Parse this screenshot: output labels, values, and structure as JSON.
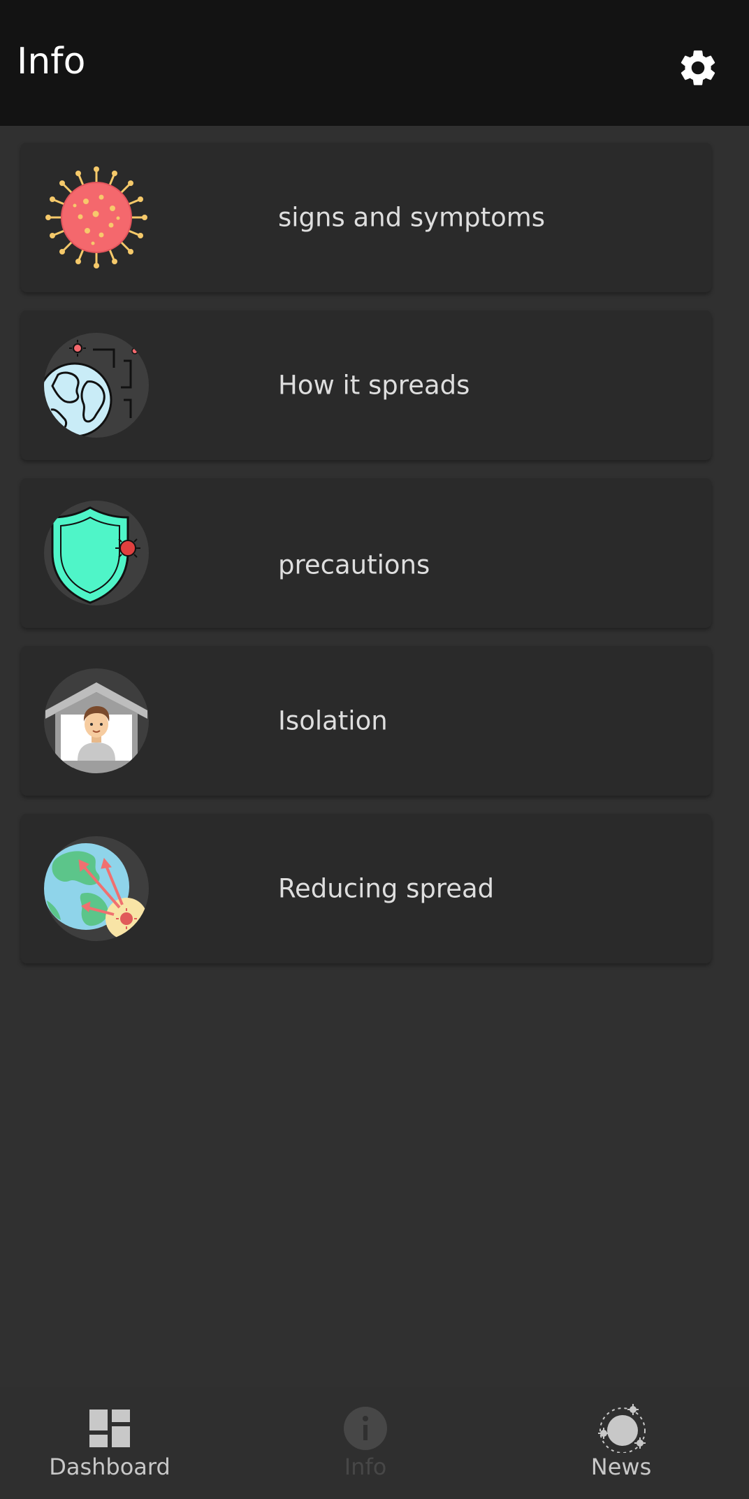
{
  "app_bar": {
    "title": "Info",
    "settings_icon": "gear-icon"
  },
  "cards": [
    {
      "label": "signs and symptoms",
      "icon": "virus-icon"
    },
    {
      "label": "How it spreads",
      "icon": "globe-spread-icon"
    },
    {
      "label": "precautions",
      "icon": "shield-virus-icon"
    },
    {
      "label": "Isolation",
      "icon": "home-isolation-icon"
    },
    {
      "label": "Reducing spread",
      "icon": "globe-reduce-spread-icon"
    }
  ],
  "bottom_nav": {
    "items": [
      {
        "label": "Dashboard",
        "icon": "dashboard-icon",
        "active": true
      },
      {
        "label": "Info",
        "icon": "info-icon",
        "active": false
      },
      {
        "label": "News",
        "icon": "news-virus-icon",
        "active": true
      }
    ]
  },
  "colors": {
    "app_bar_bg": "#131313",
    "page_bg": "#303030",
    "card_bg": "#2a2a2a",
    "label_text": "#dedede",
    "nav_inactive": "#474747"
  }
}
